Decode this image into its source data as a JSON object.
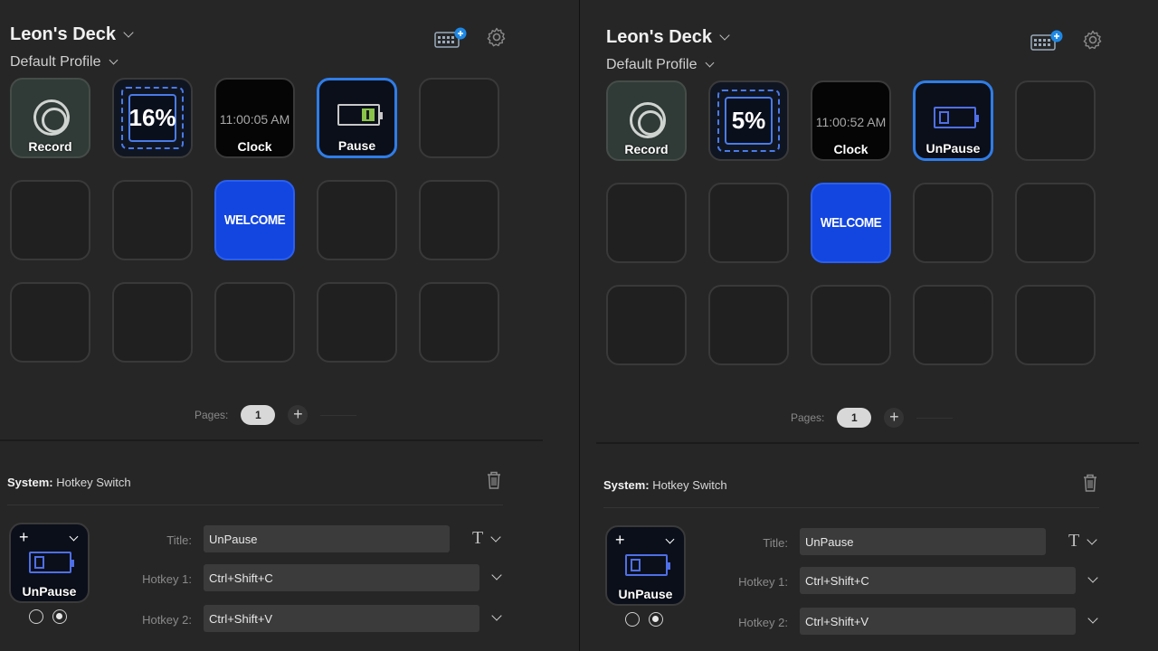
{
  "colors": {
    "accent_blue": "#2f7de8",
    "welcome_blue": "#1346e0",
    "battery_green": "#8bc34a"
  },
  "panels": [
    {
      "deck_name": "Leon's Deck",
      "profile": "Default Profile",
      "keys": {
        "record": {
          "label": "Record"
        },
        "cpu": {
          "value": "16%"
        },
        "clock": {
          "time": "11:00:05 AM",
          "label": "Clock"
        },
        "toggle": {
          "label": "Pause"
        },
        "welcome": {
          "text": "WELCOME"
        }
      },
      "pages_label": "Pages:",
      "current_page": "1",
      "add_page": "+",
      "action": {
        "category": "System:",
        "name": "Hotkey Switch"
      },
      "preview": {
        "label": "UnPause",
        "plus": "+"
      },
      "fields": {
        "title_label": "Title:",
        "title_value": "UnPause",
        "hotkey1_label": "Hotkey 1:",
        "hotkey1_value": "Ctrl+Shift+C",
        "hotkey2_label": "Hotkey 2:",
        "hotkey2_value": "Ctrl+Shift+V",
        "text_style": "T"
      }
    },
    {
      "deck_name": "Leon's Deck",
      "profile": "Default Profile",
      "keys": {
        "record": {
          "label": "Record"
        },
        "cpu": {
          "value": "5%"
        },
        "clock": {
          "time": "11:00:52 AM",
          "label": "Clock"
        },
        "toggle": {
          "label": "UnPause"
        },
        "welcome": {
          "text": "WELCOME"
        }
      },
      "pages_label": "Pages:",
      "current_page": "1",
      "add_page": "+",
      "action": {
        "category": "System:",
        "name": "Hotkey Switch"
      },
      "preview": {
        "label": "UnPause",
        "plus": "+"
      },
      "fields": {
        "title_label": "Title:",
        "title_value": "UnPause",
        "hotkey1_label": "Hotkey 1:",
        "hotkey1_value": "Ctrl+Shift+C",
        "hotkey2_label": "Hotkey 2:",
        "hotkey2_value": "Ctrl+Shift+V",
        "text_style": "T"
      }
    }
  ]
}
